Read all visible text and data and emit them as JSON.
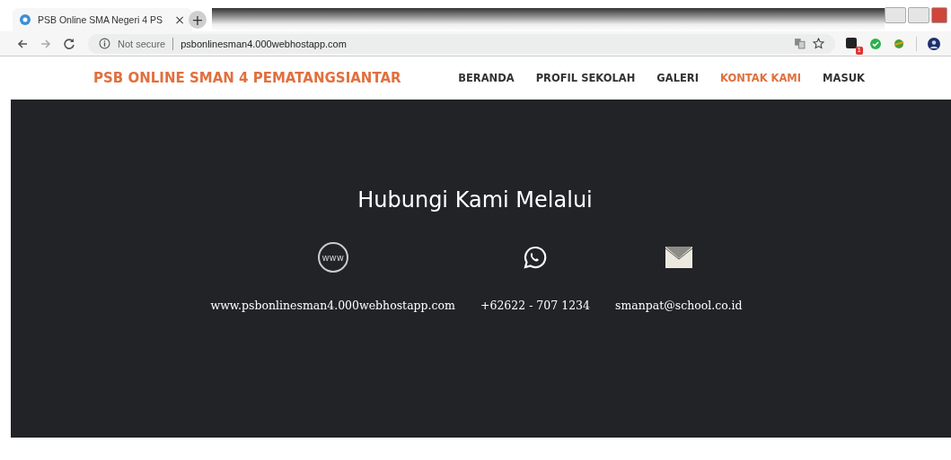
{
  "browser": {
    "tab_title": "PSB Online SMA Negeri 4 PS",
    "tab_close": "×",
    "new_tab": "+",
    "security": "Not secure",
    "url": "psbonlinesman4.000webhostapp.com",
    "extension_badge": "1"
  },
  "navbar": {
    "brand": "PSB ONLINE SMAN 4 PEMATANGSIANTAR",
    "items": [
      {
        "label": "BERANDA",
        "selected": false
      },
      {
        "label": "PROFIL SEKOLAH",
        "selected": false
      },
      {
        "label": "GALERI",
        "selected": false
      },
      {
        "label": "KONTAK KAMI",
        "selected": true
      },
      {
        "label": "MASUK",
        "selected": false
      }
    ]
  },
  "contact": {
    "heading": "Hubungi Kami Melalui",
    "channels": [
      {
        "kind": "web",
        "icon_text": "www",
        "text": "www.psbonlinesman4.000webhostapp.com"
      },
      {
        "kind": "whatsapp",
        "text": "+62622 - 707 1234"
      },
      {
        "kind": "email",
        "text": "smanpat@school.co.id"
      }
    ]
  }
}
